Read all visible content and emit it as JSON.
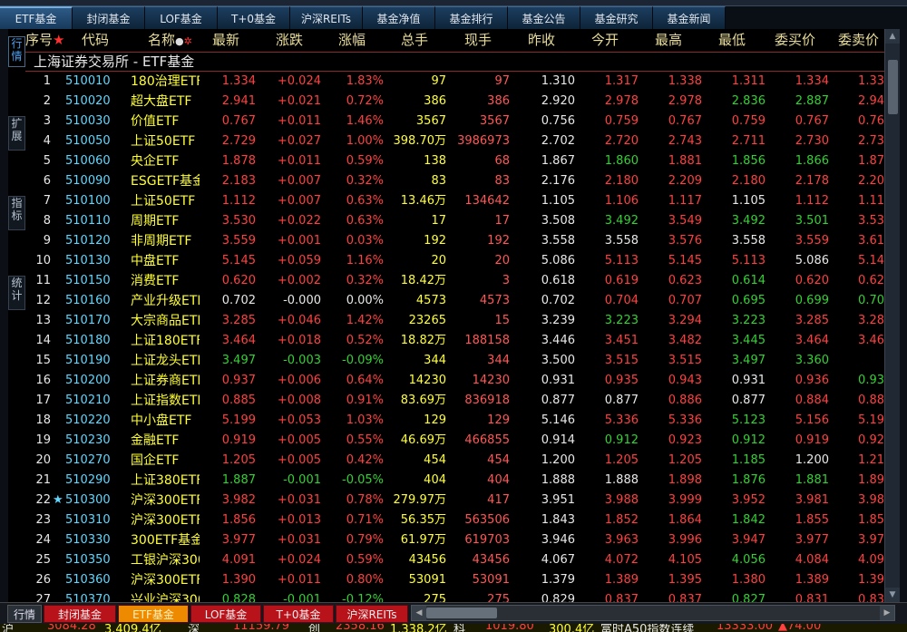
{
  "nav": {
    "tabs": [
      {
        "label": "ETF基金",
        "active": true
      },
      {
        "label": "封闭基金",
        "active": false
      },
      {
        "label": "LOF基金",
        "active": false
      },
      {
        "label": "T+0基金",
        "active": false
      },
      {
        "label": "沪深REITs",
        "active": false
      },
      {
        "label": "基金净值",
        "active": false
      },
      {
        "label": "基金排行",
        "active": false
      },
      {
        "label": "基金公告",
        "active": false
      },
      {
        "label": "基金研究",
        "active": false
      },
      {
        "label": "基金新闻",
        "active": false
      }
    ]
  },
  "sidebar": {
    "tabs": [
      {
        "label": "行情",
        "active": true
      },
      {
        "label": "扩展",
        "active": false
      },
      {
        "label": "指标",
        "active": false
      },
      {
        "label": "统计",
        "active": false
      }
    ]
  },
  "table": {
    "columns": [
      "序号",
      "代码",
      "名称",
      "最新",
      "涨跌",
      "涨幅",
      "总手",
      "现手",
      "昨收",
      "今开",
      "最高",
      "最低",
      "委买价",
      "委卖价"
    ],
    "section_title": "上海证券交易所 - ETF基金",
    "rows": [
      {
        "seq": "1",
        "star": "",
        "code": "510010",
        "name": "180治理ETF",
        "latest": "1.334",
        "chg": "+0.024",
        "pct": "1.83%",
        "vol": "97",
        "cur": "97",
        "prev": "1.310",
        "open": "1.317",
        "high": "1.338",
        "low": "1.311",
        "bid": "1.334",
        "ask": "1.33"
      },
      {
        "seq": "2",
        "star": "",
        "code": "510020",
        "name": "超大盘ETF",
        "latest": "2.941",
        "chg": "+0.021",
        "pct": "0.72%",
        "vol": "386",
        "cur": "386",
        "prev": "2.920",
        "open": "2.978",
        "high": "2.978",
        "low": "2.836",
        "bid": "2.887",
        "ask": "2.94"
      },
      {
        "seq": "3",
        "star": "",
        "code": "510030",
        "name": "价值ETF",
        "latest": "0.767",
        "chg": "+0.011",
        "pct": "1.46%",
        "vol": "3567",
        "cur": "3567",
        "prev": "0.756",
        "open": "0.759",
        "high": "0.767",
        "low": "0.759",
        "bid": "0.767",
        "ask": "0.76"
      },
      {
        "seq": "4",
        "star": "",
        "code": "510050",
        "name": "上证50ETF",
        "latest": "2.729",
        "chg": "+0.027",
        "pct": "1.00%",
        "vol": "398.70万",
        "cur": "3986973",
        "prev": "2.702",
        "open": "2.720",
        "high": "2.743",
        "low": "2.711",
        "bid": "2.730",
        "ask": "2.73"
      },
      {
        "seq": "5",
        "star": "",
        "code": "510060",
        "name": "央企ETF",
        "latest": "1.878",
        "chg": "+0.011",
        "pct": "0.59%",
        "vol": "138",
        "cur": "68",
        "prev": "1.867",
        "open": "1.860",
        "high": "1.881",
        "low": "1.856",
        "bid": "1.866",
        "ask": "1.87"
      },
      {
        "seq": "6",
        "star": "",
        "code": "510090",
        "name": "ESGETF基金",
        "latest": "2.183",
        "chg": "+0.007",
        "pct": "0.32%",
        "vol": "83",
        "cur": "83",
        "prev": "2.176",
        "open": "2.180",
        "high": "2.209",
        "low": "2.180",
        "bid": "2.178",
        "ask": "2.20"
      },
      {
        "seq": "7",
        "star": "",
        "code": "510100",
        "name": "上证50ETF",
        "latest": "1.112",
        "chg": "+0.007",
        "pct": "0.63%",
        "vol": "13.46万",
        "cur": "134642",
        "prev": "1.105",
        "open": "1.106",
        "high": "1.117",
        "low": "1.105",
        "bid": "1.112",
        "ask": "1.11"
      },
      {
        "seq": "8",
        "star": "",
        "code": "510110",
        "name": "周期ETF",
        "latest": "3.530",
        "chg": "+0.022",
        "pct": "0.63%",
        "vol": "17",
        "cur": "17",
        "prev": "3.508",
        "open": "3.492",
        "high": "3.549",
        "low": "3.492",
        "bid": "3.501",
        "ask": "3.53"
      },
      {
        "seq": "9",
        "star": "",
        "code": "510120",
        "name": "非周期ETF",
        "latest": "3.559",
        "chg": "+0.001",
        "pct": "0.03%",
        "vol": "192",
        "cur": "192",
        "prev": "3.558",
        "open": "3.558",
        "high": "3.576",
        "low": "3.558",
        "bid": "3.559",
        "ask": "3.61"
      },
      {
        "seq": "10",
        "star": "",
        "code": "510130",
        "name": "中盘ETF",
        "latest": "5.145",
        "chg": "+0.059",
        "pct": "1.16%",
        "vol": "20",
        "cur": "20",
        "prev": "5.086",
        "open": "5.113",
        "high": "5.145",
        "low": "5.113",
        "bid": "5.086",
        "ask": "5.14"
      },
      {
        "seq": "11",
        "star": "",
        "code": "510150",
        "name": "消费ETF",
        "latest": "0.620",
        "chg": "+0.002",
        "pct": "0.32%",
        "vol": "18.42万",
        "cur": "3",
        "prev": "0.618",
        "open": "0.619",
        "high": "0.623",
        "low": "0.614",
        "bid": "0.620",
        "ask": "0.62"
      },
      {
        "seq": "12",
        "star": "",
        "code": "510160",
        "name": "产业升级ETF",
        "latest": "0.702",
        "chg": "-0.000",
        "pct": "0.00%",
        "vol": "4573",
        "cur": "4573",
        "prev": "0.702",
        "open": "0.704",
        "high": "0.707",
        "low": "0.695",
        "bid": "0.699",
        "ask": "0.70"
      },
      {
        "seq": "13",
        "star": "",
        "code": "510170",
        "name": "大宗商品ETF",
        "latest": "3.285",
        "chg": "+0.046",
        "pct": "1.42%",
        "vol": "23265",
        "cur": "15",
        "prev": "3.239",
        "open": "3.223",
        "high": "3.294",
        "low": "3.223",
        "bid": "3.285",
        "ask": "3.28"
      },
      {
        "seq": "14",
        "star": "",
        "code": "510180",
        "name": "上证180ETF",
        "latest": "3.464",
        "chg": "+0.018",
        "pct": "0.52%",
        "vol": "18.82万",
        "cur": "188158",
        "prev": "3.446",
        "open": "3.451",
        "high": "3.482",
        "low": "3.445",
        "bid": "3.464",
        "ask": "3.46"
      },
      {
        "seq": "15",
        "star": "",
        "code": "510190",
        "name": "上证龙头ETF",
        "latest": "3.497",
        "chg": "-0.003",
        "pct": "-0.09%",
        "vol": "344",
        "cur": "344",
        "prev": "3.500",
        "open": "3.515",
        "high": "3.515",
        "low": "3.497",
        "bid": "3.360",
        "ask": ""
      },
      {
        "seq": "16",
        "star": "",
        "code": "510200",
        "name": "上证券商ETF",
        "latest": "0.937",
        "chg": "+0.006",
        "pct": "0.64%",
        "vol": "14230",
        "cur": "14230",
        "prev": "0.931",
        "open": "0.935",
        "high": "0.943",
        "low": "0.931",
        "bid": "0.936",
        "ask": "0.93"
      },
      {
        "seq": "17",
        "star": "",
        "code": "510210",
        "name": "上证指数ETF",
        "latest": "0.885",
        "chg": "+0.008",
        "pct": "0.91%",
        "vol": "83.69万",
        "cur": "836918",
        "prev": "0.877",
        "open": "0.877",
        "high": "0.886",
        "low": "0.877",
        "bid": "0.884",
        "ask": "0.88"
      },
      {
        "seq": "18",
        "star": "",
        "code": "510220",
        "name": "中小盘ETF",
        "latest": "5.199",
        "chg": "+0.053",
        "pct": "1.03%",
        "vol": "129",
        "cur": "129",
        "prev": "5.146",
        "open": "5.336",
        "high": "5.336",
        "low": "5.123",
        "bid": "5.156",
        "ask": "5.19"
      },
      {
        "seq": "19",
        "star": "",
        "code": "510230",
        "name": "金融ETF",
        "latest": "0.919",
        "chg": "+0.005",
        "pct": "0.55%",
        "vol": "46.69万",
        "cur": "466855",
        "prev": "0.914",
        "open": "0.912",
        "high": "0.923",
        "low": "0.912",
        "bid": "0.919",
        "ask": "0.92"
      },
      {
        "seq": "20",
        "star": "",
        "code": "510270",
        "name": "国企ETF",
        "latest": "1.205",
        "chg": "+0.005",
        "pct": "0.42%",
        "vol": "454",
        "cur": "454",
        "prev": "1.200",
        "open": "1.205",
        "high": "1.205",
        "low": "1.185",
        "bid": "1.200",
        "ask": "1.21"
      },
      {
        "seq": "21",
        "star": "",
        "code": "510290",
        "name": "上证380ETF",
        "latest": "1.887",
        "chg": "-0.001",
        "pct": "-0.05%",
        "vol": "404",
        "cur": "404",
        "prev": "1.888",
        "open": "1.888",
        "high": "1.898",
        "low": "1.876",
        "bid": "1.881",
        "ask": "1.89"
      },
      {
        "seq": "22",
        "star": "★",
        "code": "510300",
        "name": "沪深300ETF",
        "latest": "3.982",
        "chg": "+0.031",
        "pct": "0.78%",
        "vol": "279.97万",
        "cur": "417",
        "prev": "3.951",
        "open": "3.988",
        "high": "3.999",
        "low": "3.952",
        "bid": "3.981",
        "ask": "3.98"
      },
      {
        "seq": "23",
        "star": "",
        "code": "510310",
        "name": "沪深300ETF",
        "latest": "1.856",
        "chg": "+0.013",
        "pct": "0.71%",
        "vol": "56.35万",
        "cur": "563506",
        "prev": "1.843",
        "open": "1.852",
        "high": "1.864",
        "low": "1.842",
        "bid": "1.855",
        "ask": "1.85"
      },
      {
        "seq": "24",
        "star": "",
        "code": "510330",
        "name": "300ETF基金",
        "latest": "3.977",
        "chg": "+0.031",
        "pct": "0.79%",
        "vol": "61.97万",
        "cur": "619703",
        "prev": "3.946",
        "open": "3.963",
        "high": "3.996",
        "low": "3.947",
        "bid": "3.977",
        "ask": "3.97"
      },
      {
        "seq": "25",
        "star": "",
        "code": "510350",
        "name": "工银沪深300",
        "latest": "4.091",
        "chg": "+0.024",
        "pct": "0.59%",
        "vol": "43456",
        "cur": "43456",
        "prev": "4.067",
        "open": "4.072",
        "high": "4.105",
        "low": "4.056",
        "bid": "4.084",
        "ask": "4.09"
      },
      {
        "seq": "26",
        "star": "",
        "code": "510360",
        "name": "沪深300ETF",
        "latest": "1.390",
        "chg": "+0.011",
        "pct": "0.80%",
        "vol": "53091",
        "cur": "53091",
        "prev": "1.379",
        "open": "1.389",
        "high": "1.395",
        "low": "1.380",
        "bid": "1.389",
        "ask": "1.39"
      },
      {
        "seq": "27",
        "star": "",
        "code": "510370",
        "name": "兴业沪深300",
        "latest": "0.828",
        "chg": "-0.001",
        "pct": "-0.12%",
        "vol": "275",
        "cur": "275",
        "prev": "0.829",
        "open": "0.837",
        "high": "0.837",
        "low": "0.827",
        "bid": "0.831",
        "ask": "0.83"
      }
    ]
  },
  "bottom": {
    "mode_label": "行情",
    "tabs": [
      {
        "label": "封闭基金",
        "active": false
      },
      {
        "label": "ETF基金",
        "active": true
      },
      {
        "label": "LOF基金",
        "active": false
      },
      {
        "label": "T+0基金",
        "active": false
      },
      {
        "label": "沪深REITs",
        "active": false
      }
    ]
  },
  "ticker": [
    "沪",
    "3084.28",
    "3.409.4亿",
    "深",
    "11159.79",
    "创",
    "2358.16",
    "1.338.2亿",
    "科",
    "1019.80",
    "300.4亿",
    "富时A50指数连续",
    "13333.00",
    "▲74.00"
  ],
  "colors": {
    "up": "#ff4040",
    "down": "#32d232",
    "flat": "#e8e8e8",
    "code": "#5fd7ff",
    "name": "#ffff33",
    "volume": "#ffff33",
    "header": "#e8dc9a",
    "accent_tab": "#ee8a00",
    "bottom_tab": "#b8121a"
  }
}
